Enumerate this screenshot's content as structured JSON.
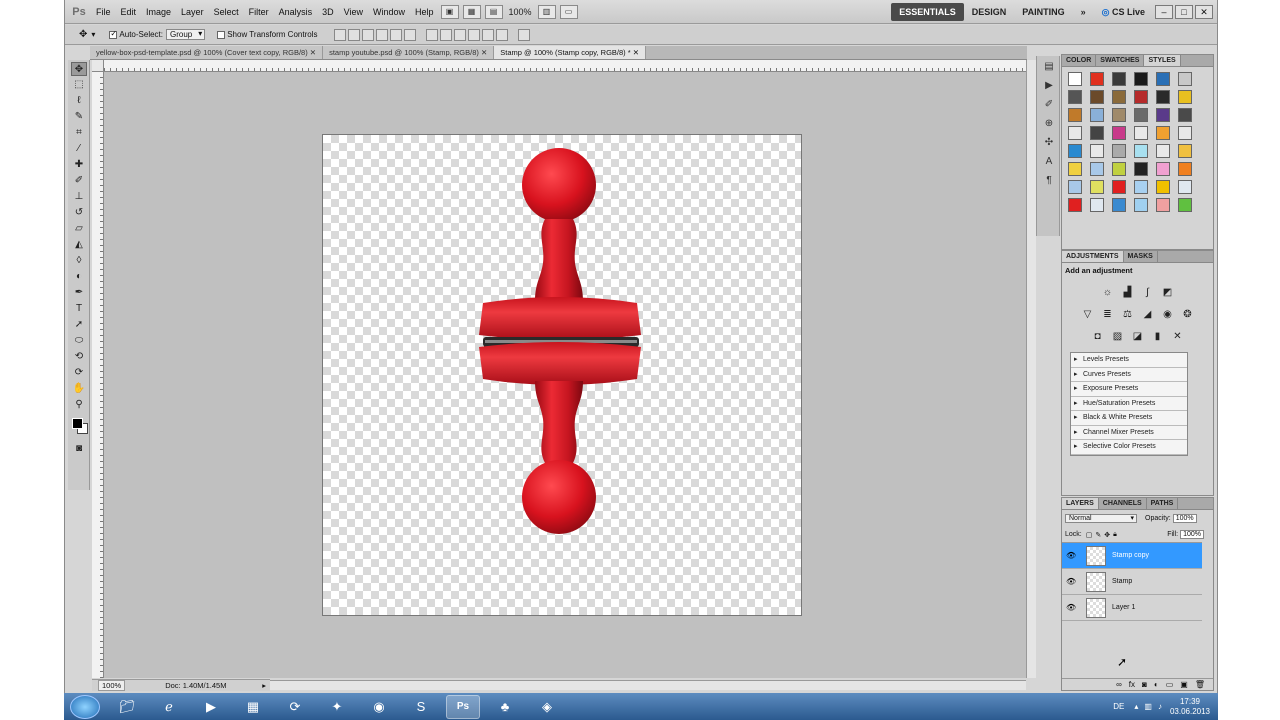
{
  "menubar": {
    "logo": "Ps",
    "items": [
      "File",
      "Edit",
      "Image",
      "Layer",
      "Select",
      "Filter",
      "Analysis",
      "3D",
      "View",
      "Window",
      "Help"
    ],
    "zoom": "100%",
    "workspaces": [
      "ESSENTIALS",
      "DESIGN",
      "PAINTING"
    ],
    "more": "»",
    "cslive": "CS Live",
    "window_buttons": [
      "–",
      "□",
      "✕"
    ]
  },
  "options": {
    "auto_select_label": "Auto-Select:",
    "auto_select_value": "Group",
    "show_transform_label": "Show Transform Controls"
  },
  "tabs": [
    "yellow-box-psd-template.psd @ 100% (Cover text copy, RGB/8) ✕",
    "stamp youtube.psd @ 100% (Stamp, RGB/8) ✕",
    "Stamp @ 100% (Stamp copy, RGB/8) * ✕"
  ],
  "status": {
    "zoom": "100%",
    "doc": "Doc: 1.40M/1.45M"
  },
  "swatches_panel": {
    "tabs": [
      "COLOR",
      "SWATCHES",
      "STYLES"
    ],
    "colors": [
      "#ffffff",
      "#e0301e",
      "#3a3a3a",
      "#1a1a1a",
      "#2a6fb5",
      "#c8c8c8",
      "#555555",
      "#6b4a2a",
      "#8a6a3a",
      "#b52a2a",
      "#2a2a2a",
      "#e8c020",
      "#c07a2a",
      "#8ab0d8",
      "#a08a6a",
      "#6a6a6a",
      "#5a3a8a",
      "#4a4a4a",
      "#e8e8e8",
      "#444444",
      "#c83a8a",
      "#e8e8e8",
      "#f0a030",
      "#e8e8e8",
      "#2a8ad0",
      "#e8e8e8",
      "#aaaaaa",
      "#a8e0f0",
      "#e8e8e8",
      "#f0c040",
      "#f0d040",
      "#a8c8e8",
      "#c0d040",
      "#222222",
      "#f0a0d0",
      "#f08020",
      "#a8c8e8",
      "#e0e060",
      "#e02020",
      "#a8d0f0",
      "#f0c000",
      "#e0e8f0",
      "#e02020",
      "#e0e8f0",
      "#3a8ad0",
      "#a0d0f0",
      "#f0a0a0",
      "#60c040"
    ]
  },
  "adjustments_panel": {
    "tabs": [
      "ADJUSTMENTS",
      "MASKS"
    ],
    "title": "Add an adjustment",
    "presets": [
      "Levels Presets",
      "Curves Presets",
      "Exposure Presets",
      "Hue/Saturation Presets",
      "Black & White Presets",
      "Channel Mixer Presets",
      "Selective Color Presets"
    ]
  },
  "layers_panel": {
    "tabs": [
      "LAYERS",
      "CHANNELS",
      "PATHS"
    ],
    "blend_mode": "Normal",
    "opacity_label": "Opacity:",
    "opacity": "100%",
    "lock_label": "Lock:",
    "fill_label": "Fill:",
    "fill": "100%",
    "layers": [
      {
        "name": "Stamp copy",
        "selected": true
      },
      {
        "name": "Stamp",
        "selected": false
      },
      {
        "name": "Layer 1",
        "selected": false
      }
    ]
  },
  "taskbar": {
    "lang": "DE",
    "time": "17:39",
    "date": "03.06.2013"
  },
  "colors": {
    "stamp_red": "#e0202a",
    "selection_blue": "#3399ff"
  }
}
